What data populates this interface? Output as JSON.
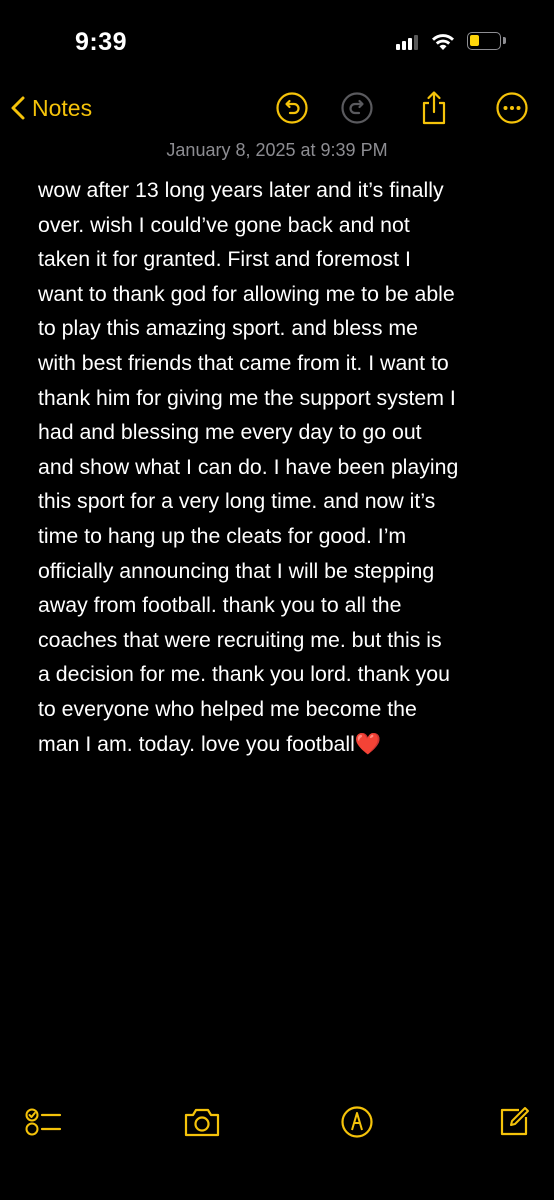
{
  "status_bar": {
    "time": "9:39",
    "battery_level": 0.35,
    "accent": "#ffd60a"
  },
  "nav": {
    "back_label": "Notes",
    "icons": [
      "chevron-left-icon",
      "undo-icon",
      "redo-icon",
      "share-icon",
      "more-icon"
    ],
    "accent": "#f5c30a"
  },
  "note": {
    "date": "January 8, 2025 at 9:39 PM",
    "lines": [
      "wow after 13 long years later and it’s finally",
      "over. wish I could’ve gone back and not",
      "taken it for granted. First and foremost I",
      "want to thank god for allowing me to be able",
      "to play this amazing sport. and bless me",
      "with best friends that came from it. I want to",
      "thank him for giving me the support system I",
      "had and blessing me every day to go out",
      "and show what I can do. I have been playing",
      "this sport for a very long time. and now it’s",
      "time to hang up the cleats for good. I’m",
      "officially announcing that I will be stepping",
      "away from football. thank you to all the",
      "coaches that were recruiting me. but this is",
      "a decision for me. thank you lord. thank you",
      "to everyone who helped me become the",
      "man I am. today. love you football❤️"
    ]
  },
  "toolbar": {
    "icons": [
      "checklist-icon",
      "camera-icon",
      "markup-icon",
      "compose-icon"
    ]
  }
}
